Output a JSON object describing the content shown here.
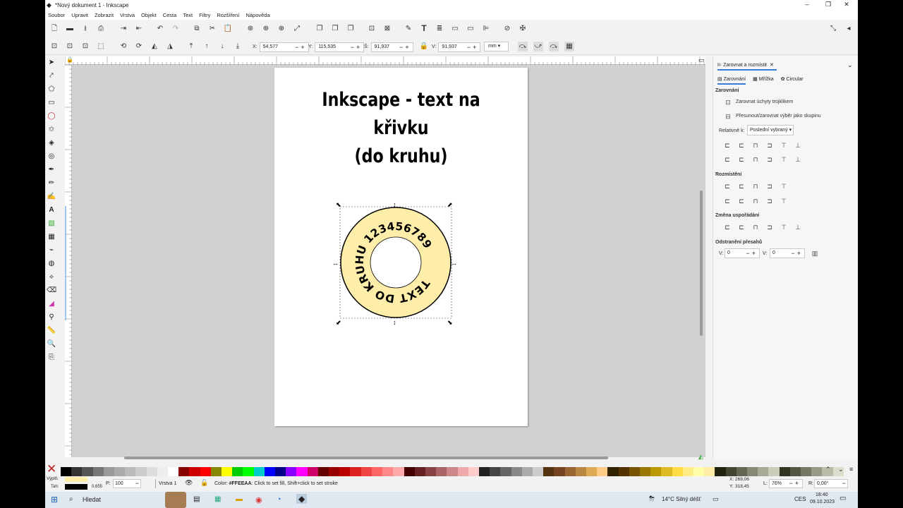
{
  "window": {
    "title": "*Nový dokument 1 - Inkscape",
    "controls": [
      "–",
      "❐",
      "✕"
    ]
  },
  "menu": [
    "Soubor",
    "Upravit",
    "Zobrazit",
    "Vrstva",
    "Objekt",
    "Cesta",
    "Text",
    "Filtry",
    "Rozšíření",
    "Nápověda"
  ],
  "toolctl": {
    "x_label": "X:",
    "x": "54,577",
    "y_label": "Y:",
    "y": "115,535",
    "w_label": "Š:",
    "w": "91,937",
    "h_label": "V:",
    "h": "91,937",
    "unit": "mm"
  },
  "canvas": {
    "heading_line1": "Inkscape - text na křivku",
    "heading_line2": "(do kruhu)",
    "circle_text": "TEXT DO KRUHU 123456789",
    "fill_color": "#FFEEAA"
  },
  "dock": {
    "tab_title": "Zarovnat a rozmístit",
    "subtabs": [
      "Zarovnání",
      "Mřížka",
      "Circular"
    ],
    "section_align": "Zarovnání",
    "opt1": "Zarovnat úchyty trojklikem",
    "opt2": "Přesunout/zarovnat výběr jako skupinu",
    "relative_label": "Relativně k:",
    "relative_value": "Poslední vybraný",
    "section_distribute": "Rozmístění",
    "section_rearrange": "Změna uspořádání",
    "section_overlap": "Odstranění přesahů",
    "h_label": "V:",
    "h_val": "0",
    "v_label": "V:",
    "v_val": "0"
  },
  "status": {
    "fill_label": "Výplň:",
    "stroke_label": "Tah:",
    "stroke_width": "0,655",
    "opacity_label": "P:",
    "opacity": "100",
    "layer": "Vrstva 1",
    "message_prefix": "Color: ",
    "message_color": "#FFEEAA",
    "message_rest": ": Click to set fill, Shift+click to set stroke",
    "cursor_x_label": "X:",
    "cursor_x": "269,06",
    "cursor_y_label": "Y:",
    "cursor_y": "318,45",
    "zoom_label": "L:",
    "zoom": "76%",
    "rotate_label": "R:",
    "rotate": "0,00°"
  },
  "taskbar": {
    "search": "Hledat",
    "weather": "14°C  Silný déšť",
    "lang": "CES",
    "time": "18:40",
    "date": "09.10.2023"
  },
  "colors": {
    "accent": "#ffeeaa",
    "selection": "#000000"
  }
}
